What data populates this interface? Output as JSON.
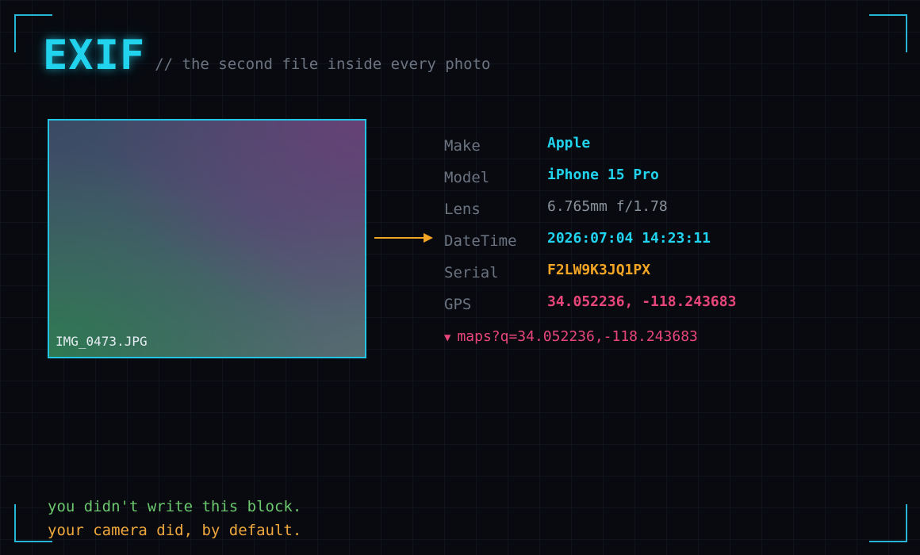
{
  "header": {
    "title": "EXIF",
    "subtitle": "// the second file inside every photo"
  },
  "photo": {
    "filename": "IMG_0473.JPG"
  },
  "exif": [
    {
      "key": "Make",
      "value": "Apple",
      "color": "#22d3ee",
      "bold": true
    },
    {
      "key": "Model",
      "value": "iPhone 15 Pro",
      "color": "#22d3ee",
      "bold": true
    },
    {
      "key": "Lens",
      "value": "6.765mm f/1.78",
      "color": "#8a929c",
      "bold": false
    },
    {
      "key": "DateTime",
      "value": "2026:07:04 14:23:11",
      "color": "#22d3ee",
      "bold": true
    },
    {
      "key": "Serial",
      "value": "F2LW9K3JQ1PX",
      "color": "#f5a524",
      "bold": true
    },
    {
      "key": "GPS",
      "value": "34.052236, -118.243683",
      "color": "#e8467a",
      "bold": true
    }
  ],
  "maps_link": {
    "icon": "triangle-down-icon",
    "text": "maps?q=34.052236,-118.243683"
  },
  "footer": {
    "line1": "you didn't write this block.",
    "line2": "your camera did, by default."
  },
  "colors": {
    "accent": "#22d3ee",
    "warn": "#f5a524",
    "danger": "#e8467a",
    "ok": "#6cc86e",
    "muted": "#6b7480",
    "background": "#080a10"
  }
}
